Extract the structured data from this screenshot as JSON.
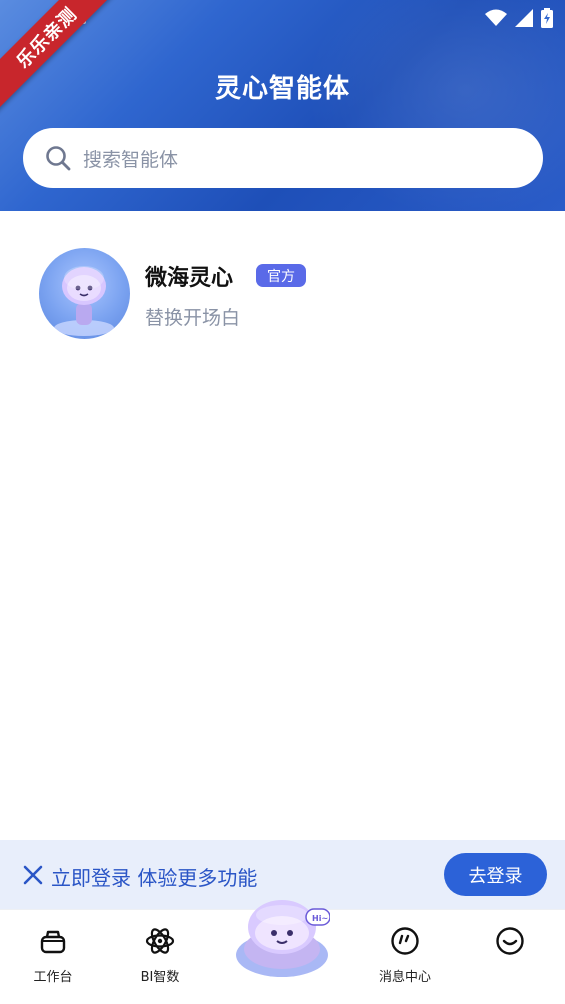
{
  "status_bar": {
    "ribbon_text": "乐乐亲测"
  },
  "header": {
    "title": "灵心智能体",
    "search": {
      "placeholder": "搜索智能体",
      "icon": "search-icon"
    }
  },
  "agents": [
    {
      "name": "微海灵心",
      "badge": "官方",
      "description": "替换开场白",
      "avatar": "robot-avatar"
    }
  ],
  "login_banner": {
    "text": "立即登录 体验更多功能",
    "button": "去登录",
    "close_icon": "close-icon"
  },
  "tabbar": {
    "tabs": [
      {
        "label": "工作台",
        "icon": "basket-icon"
      },
      {
        "label": "BI智数",
        "icon": "atom-icon"
      },
      {
        "label": "",
        "icon": "robot-center-icon"
      },
      {
        "label": "消息中心",
        "icon": "message-icon"
      },
      {
        "label": "",
        "icon": "smile-icon"
      }
    ]
  },
  "colors": {
    "header_blue": "#2f66cf",
    "badge": "#5a6ae8",
    "login_button": "#2c62d8",
    "banner_bg": "#e8eefb"
  }
}
